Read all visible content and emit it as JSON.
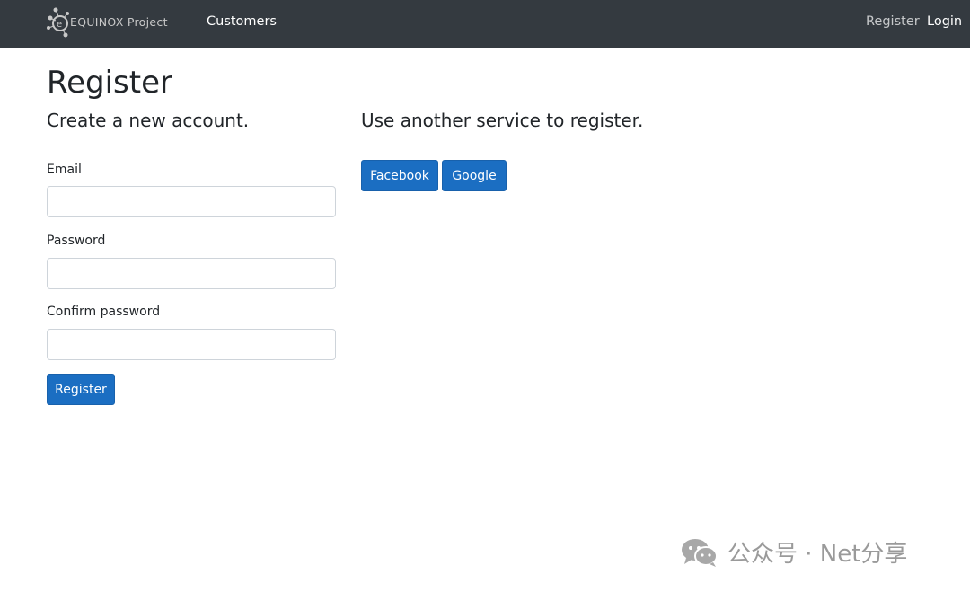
{
  "navbar": {
    "brand_text": "EQUINOX Project",
    "links": {
      "customers": "Customers",
      "register": "Register",
      "login": "Login"
    }
  },
  "page": {
    "title": "Register",
    "local_section": {
      "title": "Create a new account.",
      "fields": {
        "email": {
          "label": "Email",
          "value": "",
          "placeholder": ""
        },
        "password": {
          "label": "Password",
          "value": "",
          "placeholder": ""
        },
        "confirm_password": {
          "label": "Confirm password",
          "value": "",
          "placeholder": ""
        }
      },
      "submit_label": "Register"
    },
    "external_section": {
      "title": "Use another service to register.",
      "providers": [
        "Facebook",
        "Google"
      ]
    }
  },
  "watermark": {
    "text": "公众号 · Net分享"
  },
  "colors": {
    "navbar_bg": "#343a40",
    "primary_button": "#1b6ec2",
    "text": "#212529",
    "divider": "#e3e3e3"
  }
}
